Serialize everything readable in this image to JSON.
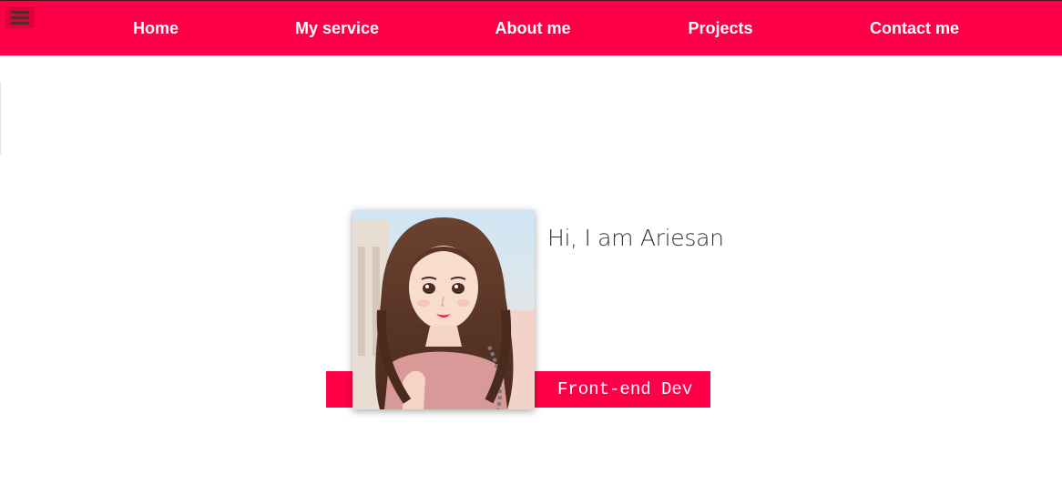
{
  "nav": {
    "menu_icon": "hamburger-menu-icon",
    "items": [
      {
        "label": "Home"
      },
      {
        "label": "My service"
      },
      {
        "label": "About me"
      },
      {
        "label": "Projects"
      },
      {
        "label": "Contact me"
      }
    ]
  },
  "hero": {
    "greeting": "Hi, I am Ariesan",
    "role": "Front-end Dev",
    "portrait_alt": "Illustrated portrait of a girl with long brown hair"
  },
  "colors": {
    "accent": "#ff0048",
    "text": "#333333",
    "background": "#ffffff"
  }
}
